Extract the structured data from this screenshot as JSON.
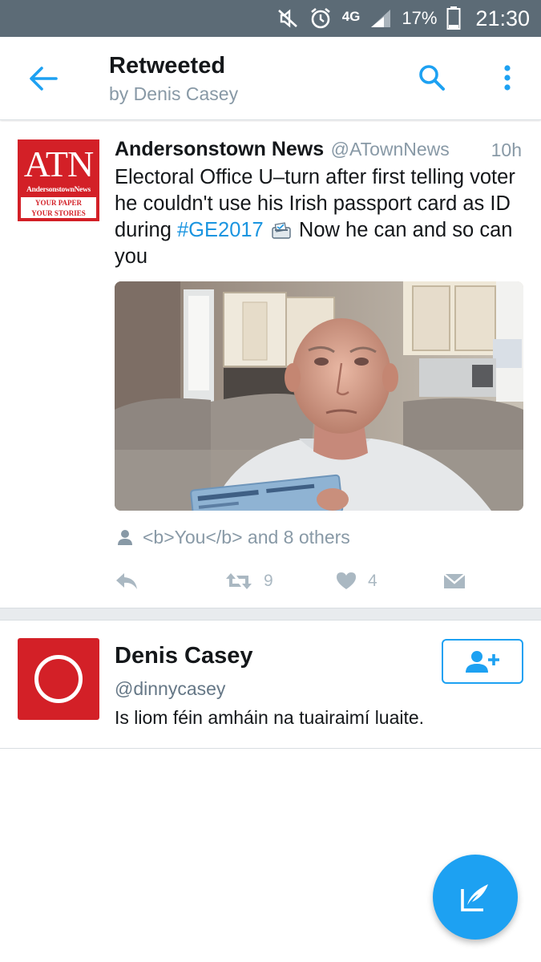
{
  "status_bar": {
    "network": "4G",
    "battery": "17%",
    "time": "21:30",
    "icons": [
      "mute-icon",
      "alarm-icon",
      "signal-icon",
      "battery-icon"
    ]
  },
  "header": {
    "title": "Retweeted",
    "subtitle": "by Denis Casey",
    "icons": [
      "back-arrow-icon",
      "search-icon",
      "overflow-menu-icon"
    ],
    "accent_color": "#1da1f2"
  },
  "tweet": {
    "avatar": {
      "logo_text": "ATN",
      "logo_name": "AndersonstownNews",
      "logo_tagline_1": "YOUR PAPER",
      "logo_tagline_2": "YOUR STORIES"
    },
    "author_name": "Andersonstown News",
    "author_handle": "@ATownNews",
    "time": "10h",
    "text_before": "Electoral Office U–turn after first telling voter he couldn't use his Irish passport card as ID during ",
    "hashtag": "#GE2017",
    "text_after": " Now he can and so can you",
    "media_description": "Photo of a man seated on a sofa in a kitchen holding an Irish passport card",
    "retweet_context": "<b>You</b> and 8 others",
    "actions": {
      "reply_count": "",
      "retweet_count": "9",
      "like_count": "4"
    }
  },
  "user_card": {
    "name": "Denis Casey",
    "handle": "@dinnycasey",
    "bio": "Is liom féin amháin na tuairaimí luaite."
  },
  "colors": {
    "status_bar": "#5c6b76",
    "brand_red": "#d32027",
    "link_blue": "#1b95e0",
    "secondary_text": "#8899a6"
  }
}
